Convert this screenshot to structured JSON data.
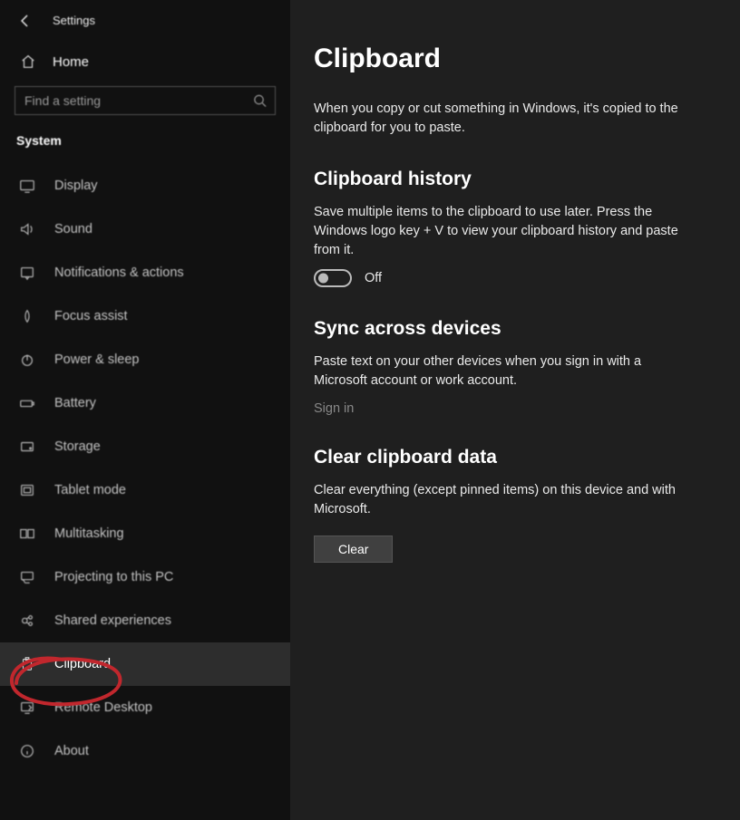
{
  "header": {
    "appTitle": "Settings",
    "home": "Home",
    "searchPlaceholder": "Find a setting",
    "category": "System"
  },
  "sidebar": {
    "items": [
      {
        "icon": "display",
        "label": "Display"
      },
      {
        "icon": "sound",
        "label": "Sound"
      },
      {
        "icon": "notifications",
        "label": "Notifications & actions"
      },
      {
        "icon": "focus",
        "label": "Focus assist"
      },
      {
        "icon": "power",
        "label": "Power & sleep"
      },
      {
        "icon": "battery",
        "label": "Battery"
      },
      {
        "icon": "storage",
        "label": "Storage"
      },
      {
        "icon": "tablet",
        "label": "Tablet mode"
      },
      {
        "icon": "multitask",
        "label": "Multitasking"
      },
      {
        "icon": "projecting",
        "label": "Projecting to this PC"
      },
      {
        "icon": "shared",
        "label": "Shared experiences"
      },
      {
        "icon": "clipboard",
        "label": "Clipboard"
      },
      {
        "icon": "remote",
        "label": "Remote Desktop"
      },
      {
        "icon": "about",
        "label": "About"
      }
    ],
    "selectedIndex": 11
  },
  "main": {
    "title": "Clipboard",
    "intro": "When you copy or cut something in Windows, it's copied to the clipboard for you to paste.",
    "history": {
      "heading": "Clipboard history",
      "desc": "Save multiple items to the clipboard to use later. Press the Windows logo key + V to view your clipboard history and paste from it.",
      "toggleState": "off",
      "toggleLabel": "Off"
    },
    "sync": {
      "heading": "Sync across devices",
      "desc": "Paste text on your other devices when you sign in with a Microsoft account or work account.",
      "link": "Sign in"
    },
    "clear": {
      "heading": "Clear clipboard data",
      "desc": "Clear everything (except pinned items) on this device and with Microsoft.",
      "button": "Clear"
    }
  }
}
